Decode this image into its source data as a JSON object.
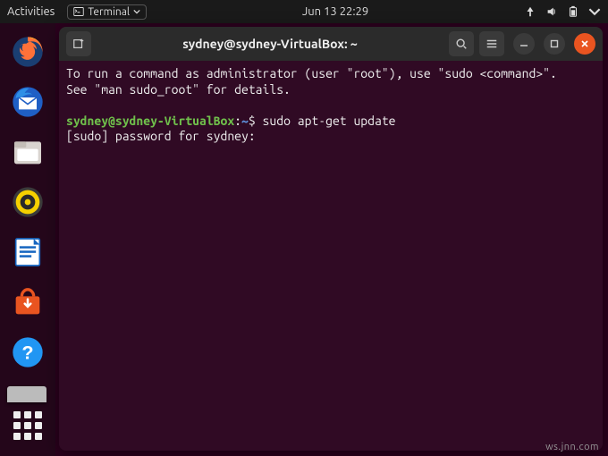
{
  "topbar": {
    "activities": "Activities",
    "terminal_label": "Terminal",
    "datetime": "Jun 13  22:29"
  },
  "window": {
    "title": "sydney@sydney-VirtualBox: ~"
  },
  "terminal": {
    "motd_line1": "To run a command as administrator (user \"root\"), use \"sudo <command>\".",
    "motd_line2": "See \"man sudo_root\" for details.",
    "prompt_user": "sydney@sydney-VirtualBox",
    "prompt_path": "~",
    "command": "sudo apt-get update",
    "password_prompt": "[sudo] password for sydney: "
  },
  "dock": {
    "items": [
      "firefox",
      "thunderbird",
      "files",
      "rhythmbox",
      "libreoffice-writer",
      "software",
      "help"
    ]
  },
  "watermark": "ws.jnn.com"
}
